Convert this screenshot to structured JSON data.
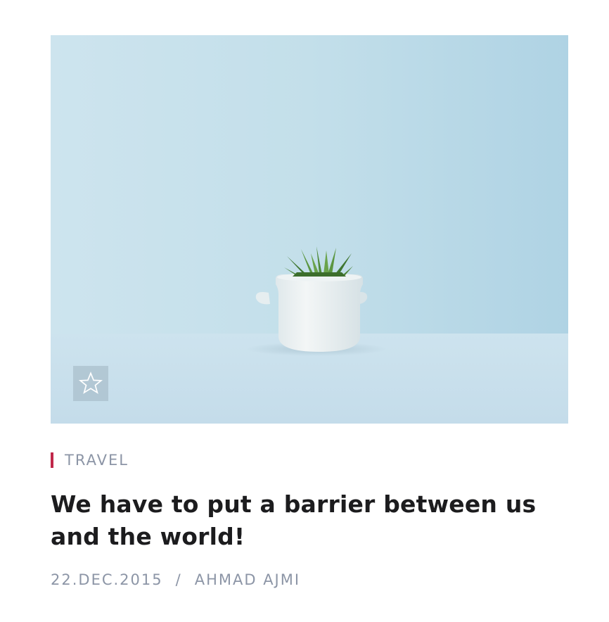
{
  "post": {
    "category": "TRAVEL",
    "title": "We have to put a barrier between us and the world!",
    "date": "22.DEC.2015",
    "separator": "/",
    "author": "AHMAD AJMI"
  },
  "image": {
    "description_icon": "potted-succulent-photo"
  },
  "favorite": {
    "icon": "star-outline-icon"
  },
  "colors": {
    "accent": "#c0284a",
    "meta_text": "#8c95a6",
    "title_text": "#1c1c1e",
    "image_bg": "#c6e0ea"
  }
}
